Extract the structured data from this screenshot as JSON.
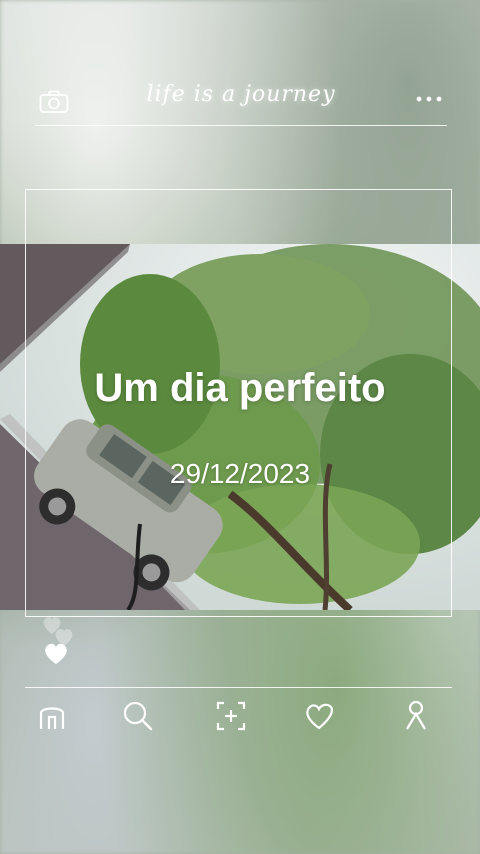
{
  "header": {
    "app_title": "life is a journey",
    "camera_icon": "camera-icon",
    "more_icon": "more-dots-icon"
  },
  "post": {
    "title": "Um dia perfeito",
    "date": "29/12/2023"
  },
  "nav": {
    "items": [
      "home-icon",
      "search-icon",
      "add-post-icon",
      "heart-icon",
      "profile-icon"
    ]
  },
  "colors": {
    "foreground": "#ffffff",
    "foliage": "#5f8a45",
    "sky": "#e8eef0",
    "car": "#a9ada5"
  }
}
